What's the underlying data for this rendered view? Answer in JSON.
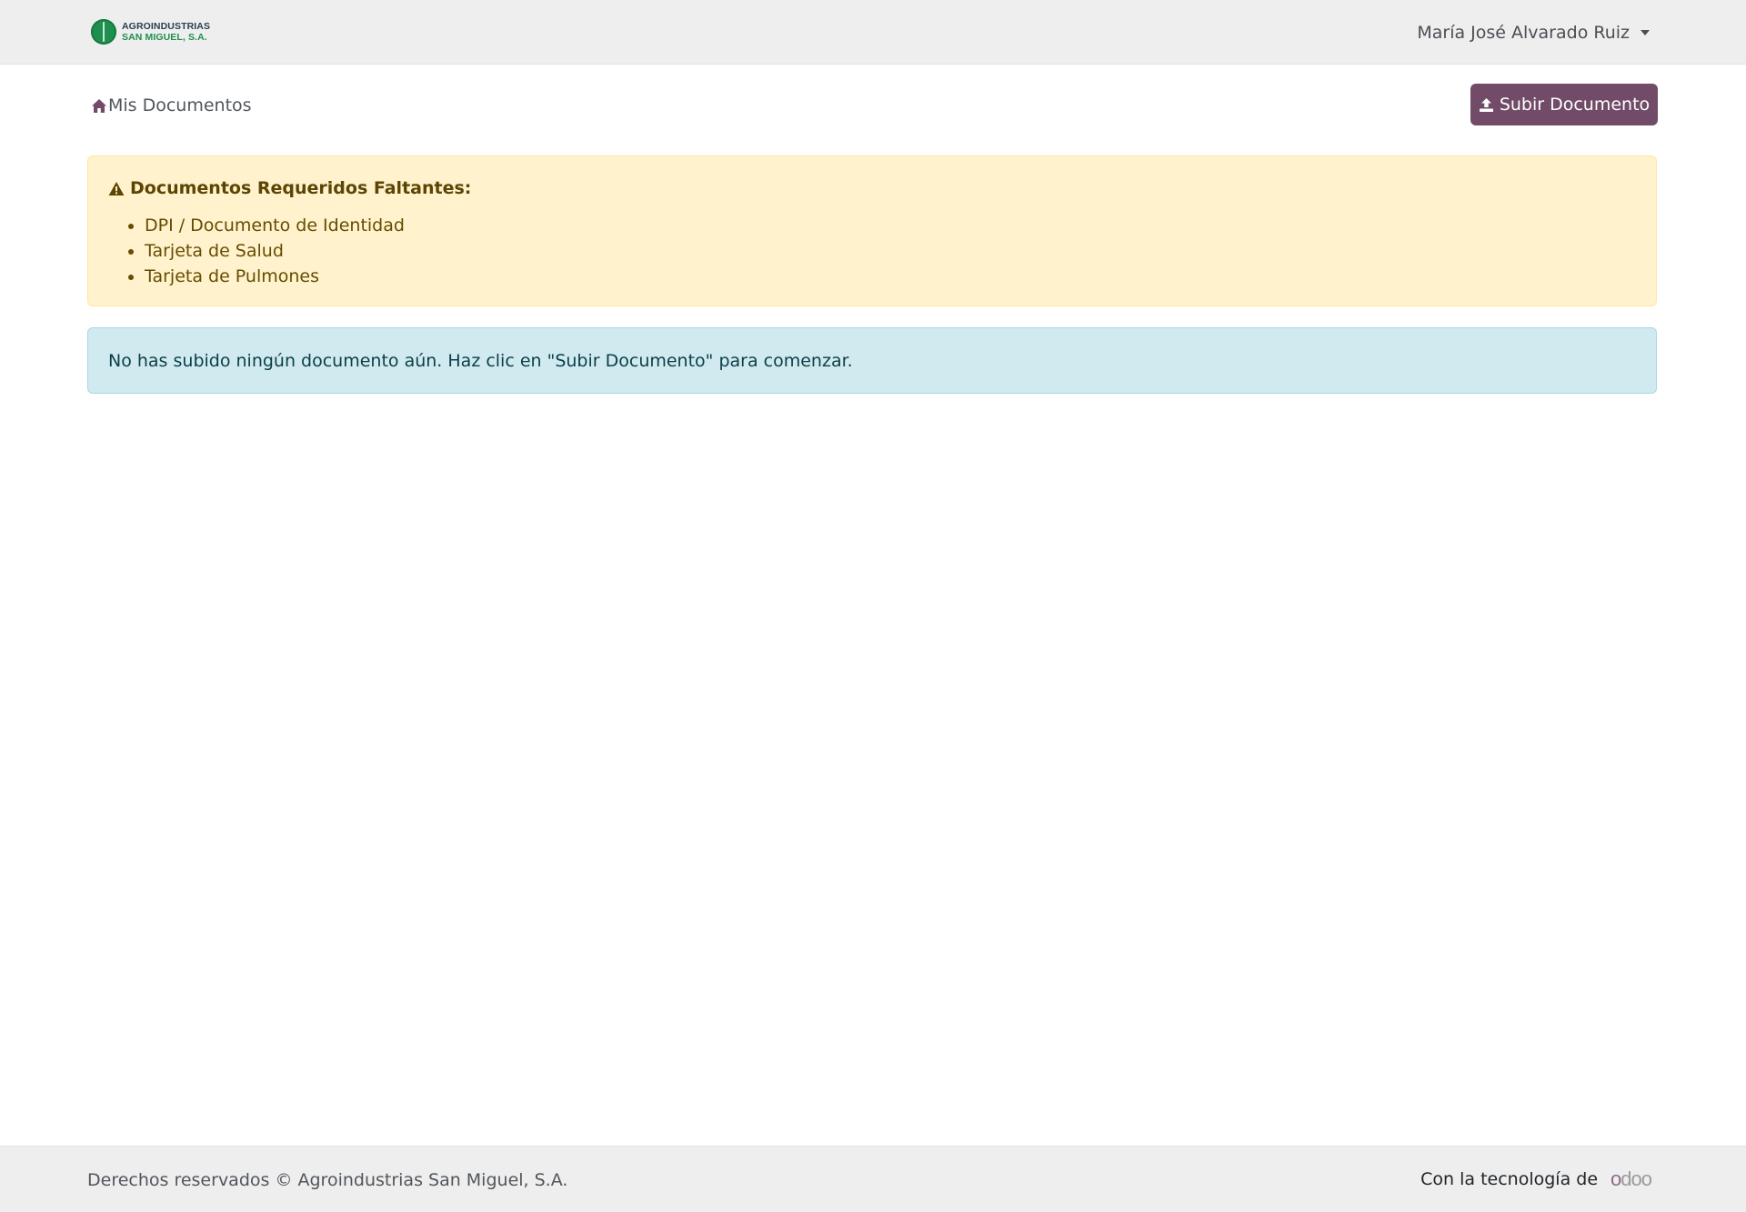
{
  "header": {
    "brand": {
      "line1": "AGROINDUSTRIAS",
      "line2": "SAN MIGUEL, S.A.",
      "logo_icon": "leaf-circle-logo"
    },
    "user_name": "María José Alvarado Ruiz",
    "user_menu_icon": "caret-down-icon"
  },
  "breadcrumb": {
    "icon": "home-icon",
    "label": "Mis Documentos"
  },
  "actions": {
    "upload_label": "Subir Documento",
    "upload_icon": "upload-icon",
    "upload_color": "#714b67"
  },
  "missing_docs_alert": {
    "icon": "warning-triangle-icon",
    "title": "Documentos Requeridos Faltantes:",
    "items": [
      "DPI / Documento de Identidad",
      "Tarjeta de Salud",
      "Tarjeta de Pulmones"
    ],
    "background": "#fff2cc"
  },
  "info_alert": {
    "message": "No has subido ningún documento aún. Haz clic en \"Subir Documento\" para comenzar.",
    "background": "#d1eaf0"
  },
  "footer": {
    "copyright": "Derechos reservados © Agroindustrias San Miguel, S.A.",
    "powered_by": "Con la tecnología de",
    "powered_logo": "odoo"
  }
}
